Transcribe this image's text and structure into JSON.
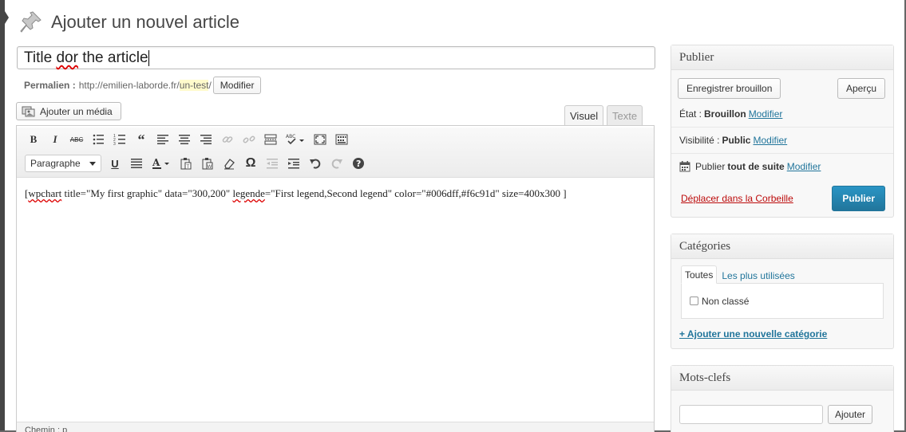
{
  "page": {
    "title": "Ajouter un nouvel article"
  },
  "post": {
    "title_before": "Title ",
    "title_typo": "dor",
    "title_after": " the article"
  },
  "permalink": {
    "label": "Permalien :",
    "base_url": "http://emilien-laborde.fr/",
    "slug": "un-test",
    "trailing": "/",
    "button": "Modifier"
  },
  "media": {
    "button": "Ajouter un média"
  },
  "editor": {
    "tabs": {
      "visual": "Visuel",
      "text": "Texte"
    },
    "format_select": "Paragraphe",
    "content_start": "[",
    "content_typo": "wpchart",
    "content_mid": " title=\"My first graphic\" data=\"300,200\" ",
    "content_typo2": "legende",
    "content_end": "=\"First legend,Second legend\" color=\"#006dff,#f6c91d\" size=400x300 ]",
    "path": "Chemin : p"
  },
  "publish": {
    "title": "Publier",
    "save_draft": "Enregistrer brouillon",
    "preview": "Aperçu",
    "status_label": "État :",
    "status_value": "Brouillon",
    "visibility_label": "Visibilité :",
    "visibility_value": "Public",
    "schedule_label": "Publier",
    "schedule_value": "tout de suite",
    "edit_link": "Modifier",
    "trash": "Déplacer dans la Corbeille",
    "publish_button": "Publier"
  },
  "categories": {
    "title": "Catégories",
    "tab_all": "Toutes",
    "tab_popular": "Les plus utilisées",
    "items": [
      "Non classé"
    ],
    "add_link": "+ Ajouter une nouvelle catégorie"
  },
  "tags": {
    "title": "Mots-clefs",
    "add_button": "Ajouter"
  },
  "colors": {
    "link": "#21759b",
    "publish_button": "#21759b",
    "trash": "#bc0b0b"
  }
}
